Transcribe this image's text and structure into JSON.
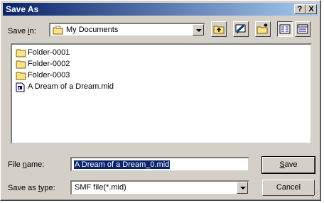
{
  "window": {
    "title": "Save As"
  },
  "title_buttons": {
    "help": "?",
    "close": "X"
  },
  "save_in": {
    "label_pre": "Save ",
    "label_accel": "i",
    "label_post": "n:",
    "value": "My Documents"
  },
  "files": [
    {
      "name": "Folder-0001",
      "icon": "folder-icon"
    },
    {
      "name": "Folder-0002",
      "icon": "folder-icon"
    },
    {
      "name": "Folder-0003",
      "icon": "folder-icon"
    },
    {
      "name": "A Dream of a Dream.mid",
      "icon": "midi-file-icon"
    }
  ],
  "file_name": {
    "label_pre": "File ",
    "label_accel": "n",
    "label_post": "ame:",
    "value": "A Dream of a Dream_0.mid"
  },
  "save_type": {
    "label_pre": "Save as ",
    "label_accel": "t",
    "label_post": "ype:",
    "value": "SMF file(*.mid)"
  },
  "buttons": {
    "save_accel": "S",
    "save_rest": "ave",
    "cancel": "Cancel"
  },
  "colors": {
    "title_active": "#0a246a",
    "face": "#d4d0c8",
    "selection": "#0a246a"
  }
}
